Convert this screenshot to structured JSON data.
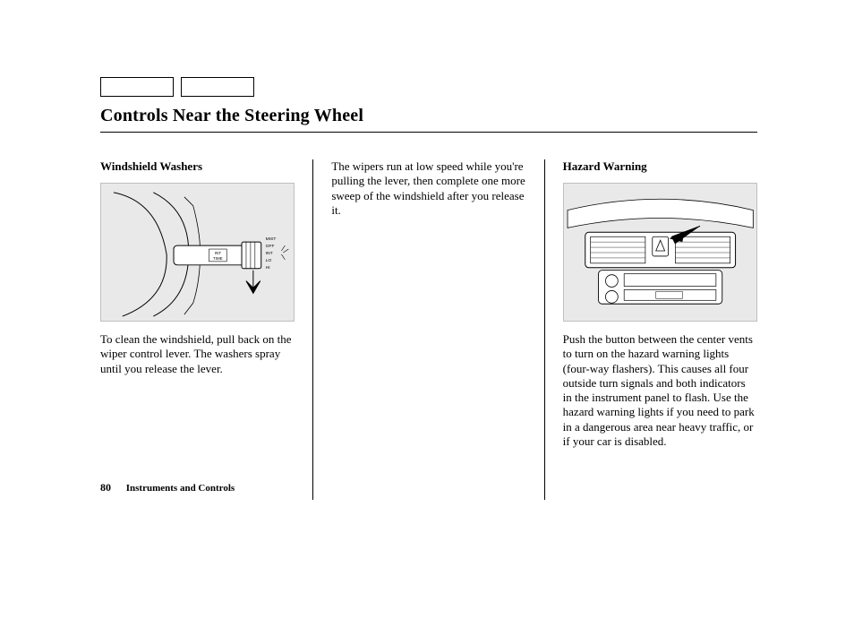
{
  "title": "Controls Near the Steering Wheel",
  "col1": {
    "heading": "Windshield Washers",
    "paragraph": "To clean the windshield, pull back on the wiper control lever. The washers spray until you release the lever.",
    "illus_labels": {
      "mist": "MIST",
      "off": "OFF",
      "int": "INT",
      "lo": "LO",
      "hi": "HI",
      "time": "INT\nTIME"
    }
  },
  "col2": {
    "paragraph": "The wipers run at low speed while you're pulling the lever, then complete one more sweep of the windshield after you release it."
  },
  "col3": {
    "heading": "Hazard Warning",
    "paragraph": "Push the button between the center vents to turn on the hazard warning lights (four-way flashers). This causes all four outside turn signals and both indicators in the instrument panel to flash. Use the hazard warning lights if you need to park in a dangerous area near heavy traffic, or if your car is disabled."
  },
  "footer": {
    "page_number": "80",
    "section": "Instruments and Controls"
  }
}
